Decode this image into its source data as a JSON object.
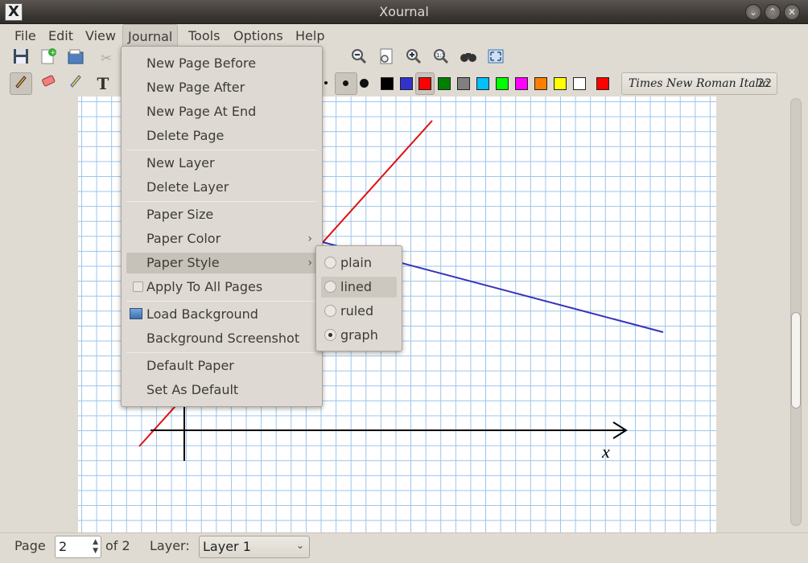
{
  "window": {
    "title": "Xournal",
    "app_icon": "X"
  },
  "menubar": [
    "File",
    "Edit",
    "View",
    "Journal",
    "Tools",
    "Options",
    "Help"
  ],
  "font": {
    "name": "Times New Roman Italic",
    "size": "22"
  },
  "toolbar_colors": [
    "#000000",
    "#3333cc",
    "#ff0000",
    "#008000",
    "#808080",
    "#00c0ff",
    "#00ff00",
    "#ff00ff",
    "#ff8000",
    "#ffff00",
    "#ffffff",
    "#ff0000"
  ],
  "journal_menu": {
    "items": [
      "New Page Before",
      "New Page After",
      "New Page At End",
      "Delete Page",
      "New Layer",
      "Delete Layer",
      "Paper Size",
      "Paper Color",
      "Paper Style",
      "Apply To All Pages",
      "Load Background",
      "Background Screenshot",
      "Default Paper",
      "Set As Default"
    ]
  },
  "paper_style_menu": {
    "items": [
      "plain",
      "lined",
      "ruled",
      "graph"
    ],
    "selected": "graph"
  },
  "canvas": {
    "axis_label": "x"
  },
  "statusbar": {
    "page_label": "Page",
    "page_value": "2",
    "of_label": "of 2",
    "layer_label": "Layer:",
    "layer_value": "Layer 1"
  }
}
